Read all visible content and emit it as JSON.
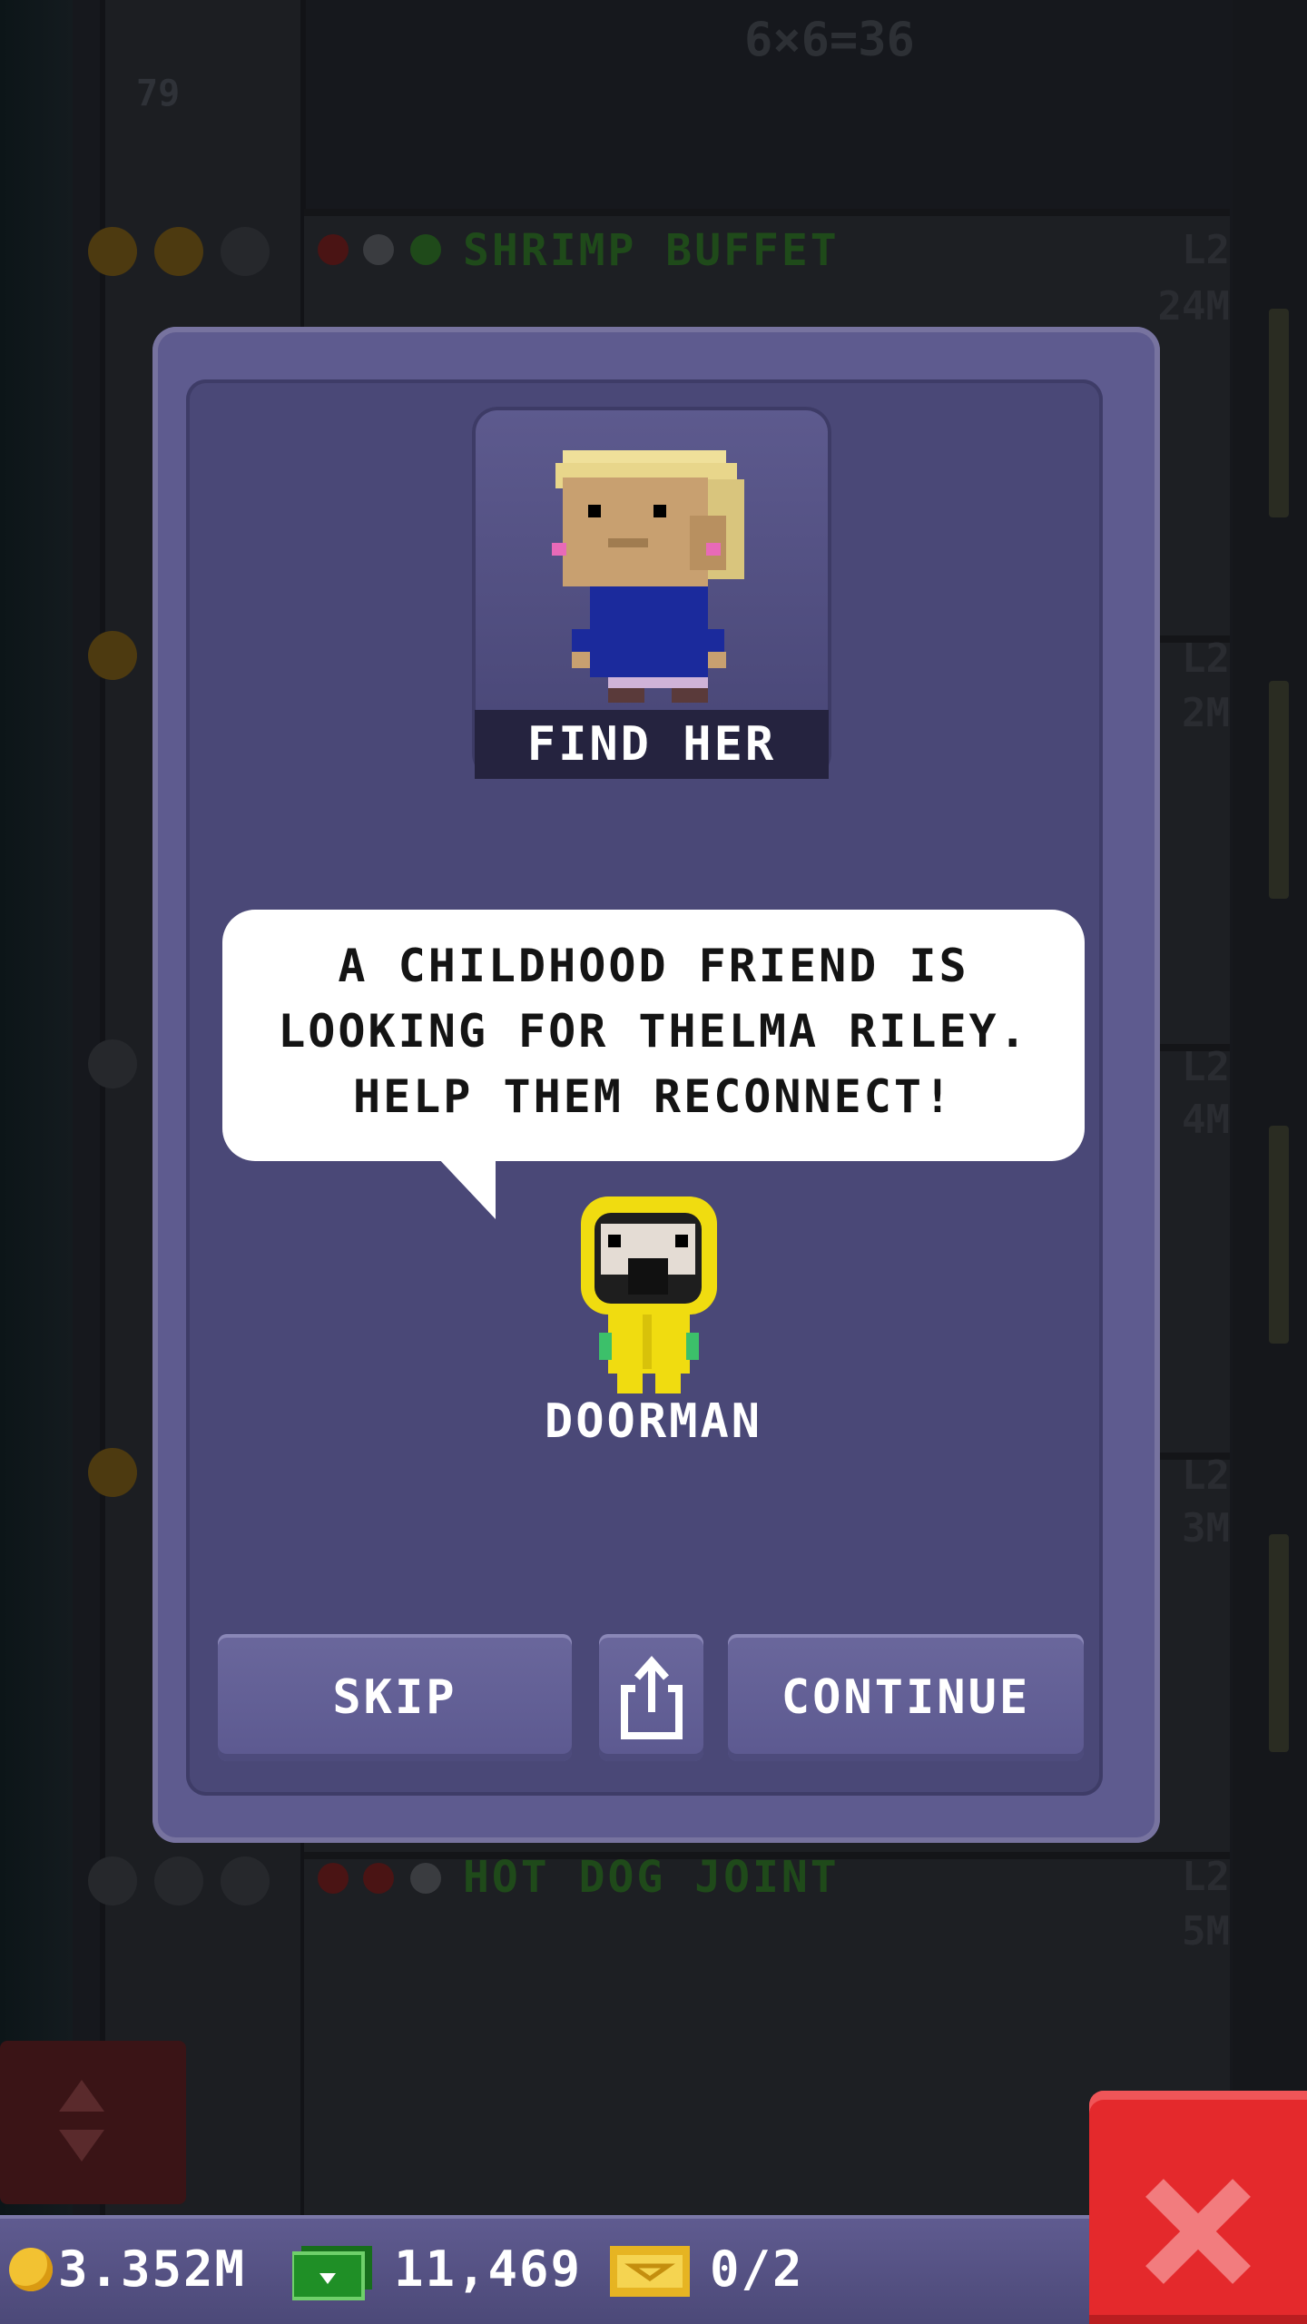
{
  "background": {
    "shaft_number": "79",
    "math_sign": "6×6=36",
    "floors": [
      {
        "name": "SHRIMP BUFFET",
        "level": "L2",
        "cost": "24M",
        "stars_on": 2
      },
      {
        "name": "",
        "level": "L2",
        "cost": "2M",
        "stars_on": 1
      },
      {
        "name": "",
        "level": "L2",
        "cost": "4M",
        "stars_on": 0
      },
      {
        "name": "",
        "level": "L2",
        "cost": "3M",
        "stars_on": 1
      },
      {
        "name": "HOT DOG JOINT",
        "level": "L2",
        "cost": "5M",
        "stars_on": 0
      }
    ]
  },
  "modal": {
    "mission_label": "FIND HER",
    "message": "A CHILDHOOD FRIEND IS LOOKING FOR THELMA RILEY. HELP THEM RECONNECT!",
    "npc_name": "DOORMAN",
    "skip_label": "SKIP",
    "continue_label": "CONTINUE",
    "share_icon": "share-icon"
  },
  "hud": {
    "coins": "3.352M",
    "bux": "11,469",
    "tickets": "0/2"
  },
  "colors": {
    "modal_bg": "#4a4877",
    "close_button": "#e4292c",
    "coin": "#f2c232",
    "bux": "#1f8f26"
  }
}
